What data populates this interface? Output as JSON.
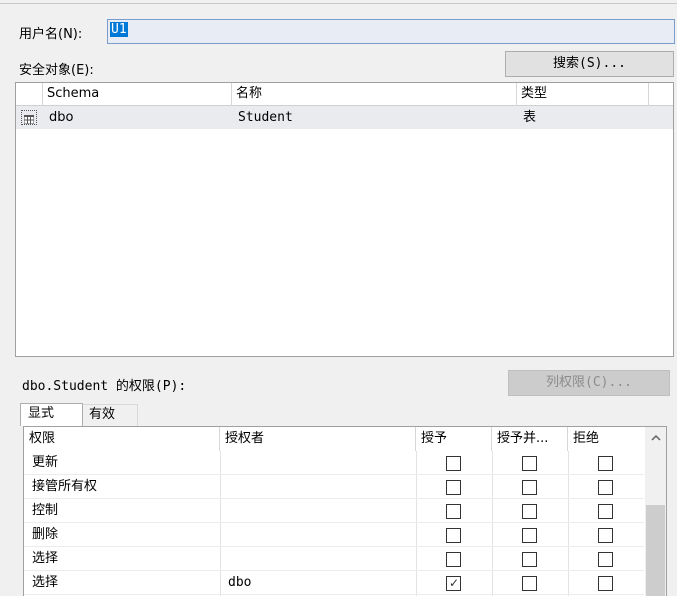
{
  "username": {
    "label": "用户名(N):",
    "value": "U1"
  },
  "securables": {
    "label": "安全对象(E):",
    "search_button": "搜索(S)...",
    "columns": [
      "Schema",
      "名称",
      "类型"
    ],
    "rows": [
      {
        "schema": "dbo",
        "name": "Student",
        "type": "表",
        "icon": "table-icon"
      }
    ]
  },
  "permissions": {
    "label": "dbo.Student 的权限(P):",
    "column_permissions_button": "列权限(C)...",
    "tabs": [
      "显式",
      "有效"
    ],
    "columns": [
      "权限",
      "授权者",
      "授予",
      "授予并...",
      "拒绝"
    ],
    "rows": [
      {
        "permission": "更新",
        "grantor": "",
        "grant": false,
        "with_grant": false,
        "deny": false
      },
      {
        "permission": "接管所有权",
        "grantor": "",
        "grant": false,
        "with_grant": false,
        "deny": false
      },
      {
        "permission": "控制",
        "grantor": "",
        "grant": false,
        "with_grant": false,
        "deny": false
      },
      {
        "permission": "删除",
        "grantor": "",
        "grant": false,
        "with_grant": false,
        "deny": false
      },
      {
        "permission": "选择",
        "grantor": "",
        "grant": false,
        "with_grant": false,
        "deny": false
      },
      {
        "permission": "选择",
        "grantor": "dbo",
        "grant": true,
        "with_grant": false,
        "deny": false
      }
    ]
  },
  "icons": {
    "check": "✓",
    "scroll_up": "chevron-up-icon"
  },
  "colors": {
    "selection": "#0078d7",
    "row_highlight": "#e9ebef"
  }
}
